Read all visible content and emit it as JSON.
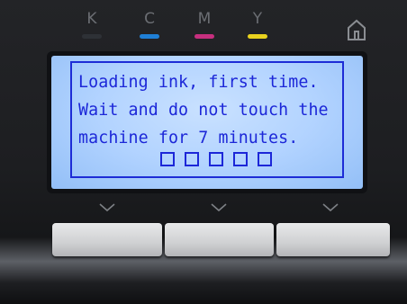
{
  "ink_levels": [
    {
      "label": "K",
      "color": "#2e3136"
    },
    {
      "label": "C",
      "color": "#1f7fd6"
    },
    {
      "label": "M",
      "color": "#c62f7e"
    },
    {
      "label": "Y",
      "color": "#e9d21e"
    }
  ],
  "home_icon": "home-icon",
  "lcd": {
    "lines": [
      "Loading ink, first time.",
      "Wait and do not touch the",
      "machine for 7 minutes."
    ],
    "progress": {
      "filled": 0,
      "total": 5
    },
    "text_color": "#1c27d8"
  },
  "soft_buttons": [
    {
      "icon": "chevron-down-icon"
    },
    {
      "icon": "chevron-down-icon"
    },
    {
      "icon": "chevron-down-icon"
    }
  ]
}
